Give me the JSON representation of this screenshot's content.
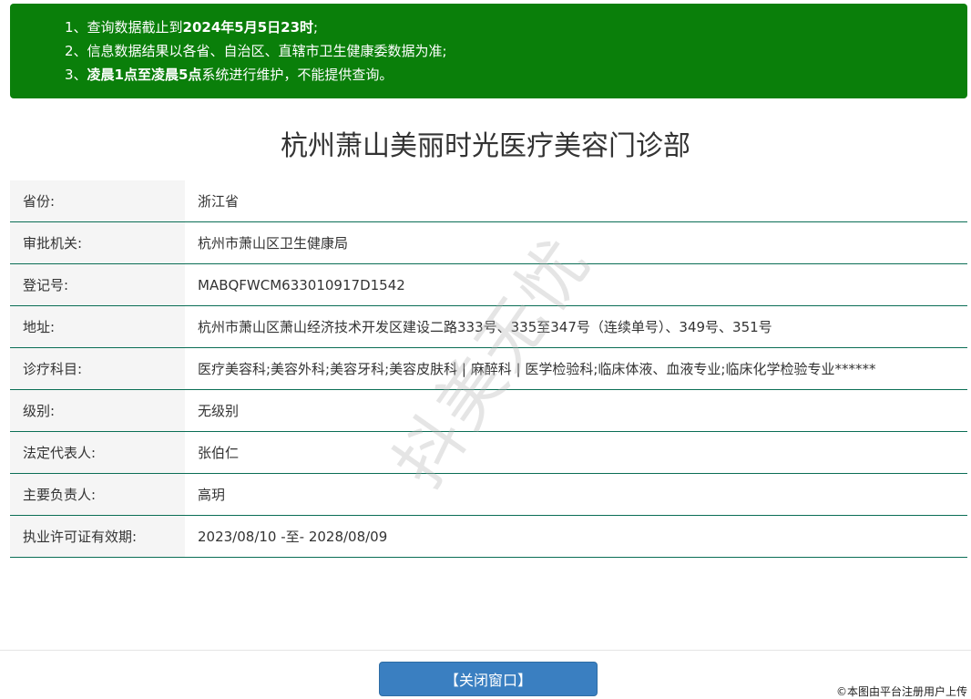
{
  "notice": {
    "lines": [
      {
        "prefix": "1、查询数据截止到",
        "bold": "2024年5月5日23时",
        "suffix": ";"
      },
      {
        "prefix": "2、信息数据结果以各省、自治区、直辖市卫生健康委数据为准;",
        "bold": "",
        "suffix": ""
      },
      {
        "prefix": "3、",
        "bold": "凌晨1点至凌晨5点",
        "suffix": "系统进行维护，不能提供查询。"
      }
    ]
  },
  "title": "杭州萧山美丽时光医疗美容门诊部",
  "rows": [
    {
      "label": "省份:",
      "value": "浙江省"
    },
    {
      "label": "审批机关:",
      "value": "杭州市萧山区卫生健康局"
    },
    {
      "label": "登记号:",
      "value": "MABQFWCM633010917D1542"
    },
    {
      "label": "地址:",
      "value": "杭州市萧山区萧山经济技术开发区建设二路333号、335至347号（连续单号）、349号、351号"
    },
    {
      "label": "诊疗科目:",
      "value": "医疗美容科;美容外科;美容牙科;美容皮肤科 | 麻醉科 | 医学检验科;临床体液、血液专业;临床化学检验专业******"
    },
    {
      "label": "级别:",
      "value": "无级别"
    },
    {
      "label": "法定代表人:",
      "value": "张伯仁"
    },
    {
      "label": "主要负责人:",
      "value": "高玥"
    },
    {
      "label": "执业许可证有效期:",
      "value": "2023/08/10 -至- 2028/08/09"
    }
  ],
  "watermark": "抖美无忧",
  "close_button": "【关闭窗口】",
  "copyright": "©本图由平台注册用户上传"
}
